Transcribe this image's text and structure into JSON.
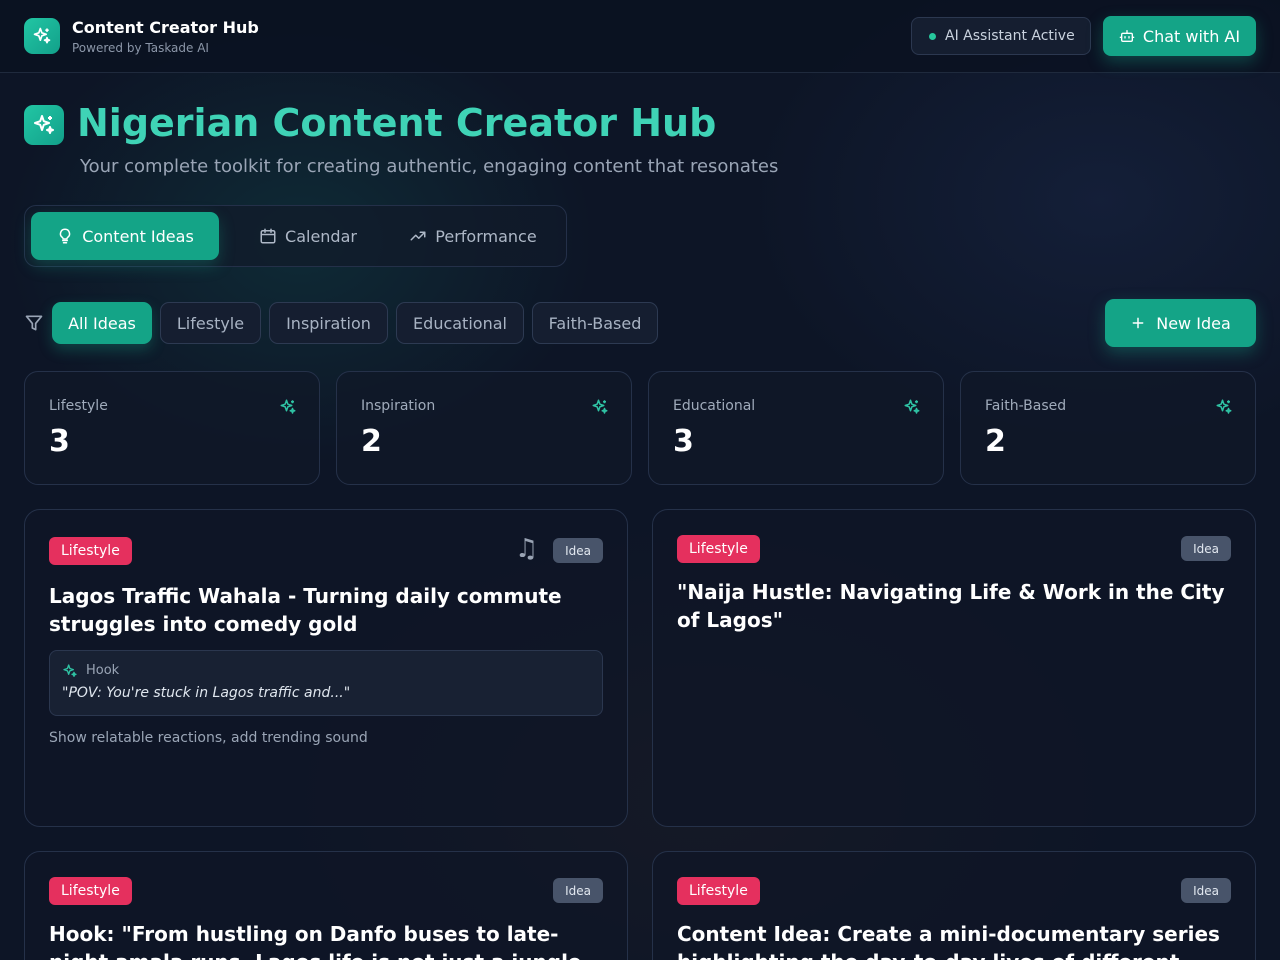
{
  "app": {
    "title": "Content Creator Hub",
    "subtitle": "Powered by Taskade AI",
    "status": "AI Assistant Active",
    "chat_label": "Chat with AI"
  },
  "hero": {
    "title": "Nigerian Content Creator Hub",
    "subtitle": "Your complete toolkit for creating authentic, engaging content that resonates"
  },
  "tabs": [
    {
      "label": "Content Ideas",
      "icon": "lightbulb-icon",
      "active": true
    },
    {
      "label": "Calendar",
      "icon": "calendar-icon",
      "active": false
    },
    {
      "label": "Performance",
      "icon": "trending-up-icon",
      "active": false
    }
  ],
  "filters": {
    "chips": [
      "All Ideas",
      "Lifestyle",
      "Inspiration",
      "Educational",
      "Faith-Based"
    ],
    "active": "All Ideas",
    "new_label": "New Idea"
  },
  "stats": [
    {
      "label": "Lifestyle",
      "value": "3"
    },
    {
      "label": "Inspiration",
      "value": "2"
    },
    {
      "label": "Educational",
      "value": "3"
    },
    {
      "label": "Faith-Based",
      "value": "2"
    }
  ],
  "cards": [
    {
      "category": "Lifestyle",
      "status": "Idea",
      "title": "Lagos Traffic Wahala - Turning daily commute struggles into comedy gold",
      "hook_label": "Hook",
      "hook": "\"POV: You're stuck in Lagos traffic and...\"",
      "description": "Show relatable reactions, add trending sound"
    },
    {
      "category": "Lifestyle",
      "status": "Idea",
      "title": "\"Naija Hustle: Navigating Life & Work in the City of Lagos\""
    },
    {
      "category": "Lifestyle",
      "status": "Idea",
      "title": "Hook: \"From hustling on Danfo buses to late-night amala runs, Lagos life is not just a jungle"
    },
    {
      "category": "Lifestyle",
      "status": "Idea",
      "title": "Content Idea: Create a mini-documentary series highlighting the day-to-day lives of different"
    }
  ],
  "colors": {
    "accent": "#14a487",
    "accent_text": "#3fd3b6",
    "lifestyle_badge": "#e5305e",
    "background": "#0d1526"
  }
}
